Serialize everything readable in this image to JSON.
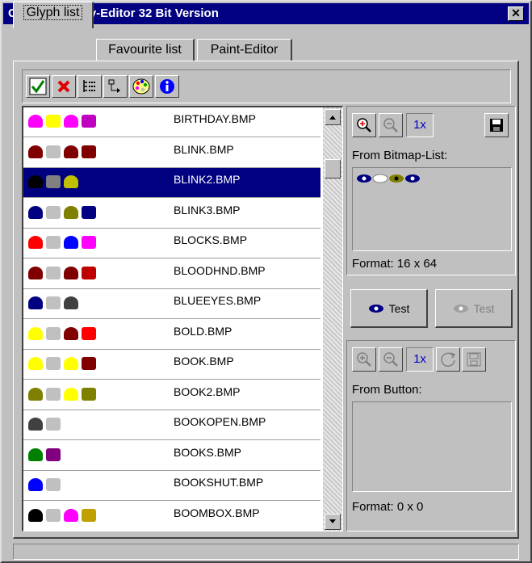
{
  "window": {
    "title": "Glyph-Property-Editor 32 Bit Version",
    "close_glyph": "✕"
  },
  "tabs": [
    {
      "label": "Glyph list"
    },
    {
      "label": "Favourite list"
    },
    {
      "label": "Paint-Editor"
    }
  ],
  "toolbar": {
    "buttons": [
      {
        "icon": "checkmark-icon"
      },
      {
        "icon": "delete-x-icon"
      },
      {
        "icon": "tree-list-icon"
      },
      {
        "icon": "export-icon"
      },
      {
        "icon": "palette-icon"
      },
      {
        "icon": "info-icon"
      }
    ]
  },
  "glyphs": [
    {
      "name": "BIRTHDAY.BMP",
      "colors": [
        "#ff00ff",
        "#ffff00",
        "#ff00ff",
        "#c000c0"
      ]
    },
    {
      "name": "BLINK.BMP",
      "colors": [
        "#800000",
        "#c0c0c0",
        "#800000",
        "#800000"
      ]
    },
    {
      "name": "BLINK2.BMP",
      "colors": [
        "#000000",
        "#808080",
        "#c0c000",
        "#000080"
      ]
    },
    {
      "name": "BLINK3.BMP",
      "colors": [
        "#000080",
        "#c0c0c0",
        "#808000",
        "#000080"
      ]
    },
    {
      "name": "BLOCKS.BMP",
      "colors": [
        "#ff0000",
        "#c0c0c0",
        "#0000ff",
        "#ff00ff"
      ]
    },
    {
      "name": "BLOODHND.BMP",
      "colors": [
        "#800000",
        "#c0c0c0",
        "#800000",
        "#c00000"
      ]
    },
    {
      "name": "BLUEEYES.BMP",
      "colors": [
        "#000080",
        "#c0c0c0",
        "#404040",
        "#ffffff"
      ]
    },
    {
      "name": "BOLD.BMP",
      "colors": [
        "#ffff00",
        "#c0c0c0",
        "#800000",
        "#ff0000"
      ]
    },
    {
      "name": "BOOK.BMP",
      "colors": [
        "#ffff00",
        "#c0c0c0",
        "#ffff00",
        "#800000"
      ]
    },
    {
      "name": "BOOK2.BMP",
      "colors": [
        "#808000",
        "#c0c0c0",
        "#ffff00",
        "#808000"
      ]
    },
    {
      "name": "BOOKOPEN.BMP",
      "colors": [
        "#404040",
        "#c0c0c0",
        "#ffffff",
        "#ffffff"
      ]
    },
    {
      "name": "BOOKS.BMP",
      "colors": [
        "#008000",
        "#800080",
        "#ffffff",
        "#ffffff"
      ]
    },
    {
      "name": "BOOKSHUT.BMP",
      "colors": [
        "#0000ff",
        "#c0c0c0",
        "#ffffff",
        "#ffffff"
      ]
    },
    {
      "name": "BOOMBOX.BMP",
      "colors": [
        "#000000",
        "#c0c0c0",
        "#ff00ff",
        "#c0a000"
      ]
    }
  ],
  "selected_index": 2,
  "right_panel": {
    "bitmap": {
      "zoom_in_icon": "zoom-in-icon",
      "zoom_out_icon": "zoom-out-icon",
      "zoom_level": "1x",
      "save_icon": "save-icon",
      "label": "From Bitmap-List:",
      "format": "Format:  16 x 64"
    },
    "test_buttons": [
      {
        "label": "Test",
        "enabled": true
      },
      {
        "label": "Test",
        "enabled": false
      }
    ],
    "button": {
      "zoom_level": "1x",
      "label": "From Button:",
      "format": "Format:  0 x 0"
    }
  },
  "status": {
    "text": ""
  }
}
